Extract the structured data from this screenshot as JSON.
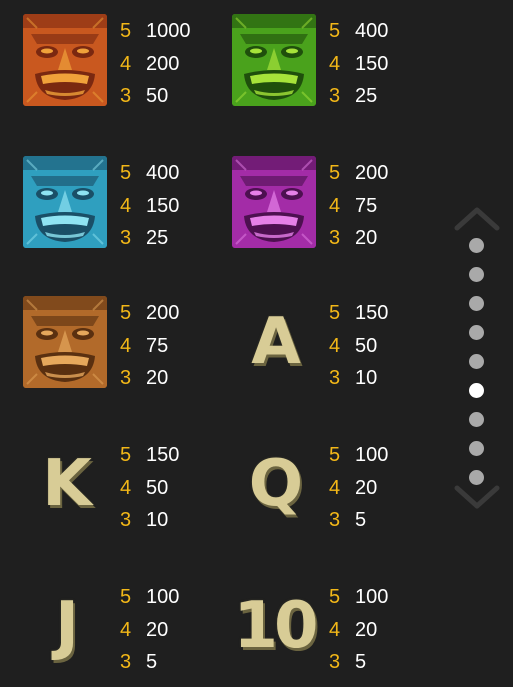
{
  "paytable": {
    "symbols": [
      {
        "name": "Red tiki mask",
        "kind": "mask",
        "colors": {
          "face": "#c9581f",
          "dark": "#7a2810",
          "light": "#f0a13a"
        },
        "pays": [
          {
            "count": "5",
            "value": "1000"
          },
          {
            "count": "4",
            "value": "200"
          },
          {
            "count": "3",
            "value": "50"
          }
        ]
      },
      {
        "name": "Green tiki mask",
        "kind": "mask",
        "colors": {
          "face": "#4aa21c",
          "dark": "#1f4f0c",
          "light": "#a6e33a"
        },
        "pays": [
          {
            "count": "5",
            "value": "400"
          },
          {
            "count": "4",
            "value": "150"
          },
          {
            "count": "3",
            "value": "25"
          }
        ]
      },
      {
        "name": "Blue tiki mask",
        "kind": "mask",
        "colors": {
          "face": "#2f9fbf",
          "dark": "#1a4f67",
          "light": "#8fe3f2"
        },
        "pays": [
          {
            "count": "5",
            "value": "400"
          },
          {
            "count": "4",
            "value": "150"
          },
          {
            "count": "3",
            "value": "25"
          }
        ]
      },
      {
        "name": "Purple tiki mask",
        "kind": "mask",
        "colors": {
          "face": "#a32ca7",
          "dark": "#4d1050",
          "light": "#e680e8"
        },
        "pays": [
          {
            "count": "5",
            "value": "200"
          },
          {
            "count": "4",
            "value": "75"
          },
          {
            "count": "3",
            "value": "20"
          }
        ]
      },
      {
        "name": "Brown tiki mask",
        "kind": "mask",
        "colors": {
          "face": "#b26a2a",
          "dark": "#5a3010",
          "light": "#e6a85c"
        },
        "pays": [
          {
            "count": "5",
            "value": "200"
          },
          {
            "count": "4",
            "value": "75"
          },
          {
            "count": "3",
            "value": "20"
          }
        ]
      },
      {
        "name": "A",
        "kind": "letter",
        "glyph": "A",
        "pays": [
          {
            "count": "5",
            "value": "150"
          },
          {
            "count": "4",
            "value": "50"
          },
          {
            "count": "3",
            "value": "10"
          }
        ]
      },
      {
        "name": "K",
        "kind": "letter",
        "glyph": "K",
        "pays": [
          {
            "count": "5",
            "value": "150"
          },
          {
            "count": "4",
            "value": "50"
          },
          {
            "count": "3",
            "value": "10"
          }
        ]
      },
      {
        "name": "Q",
        "kind": "letter",
        "glyph": "Q",
        "pays": [
          {
            "count": "5",
            "value": "100"
          },
          {
            "count": "4",
            "value": "20"
          },
          {
            "count": "3",
            "value": "5"
          }
        ]
      },
      {
        "name": "J",
        "kind": "letter",
        "glyph": "J",
        "pays": [
          {
            "count": "5",
            "value": "100"
          },
          {
            "count": "4",
            "value": "20"
          },
          {
            "count": "3",
            "value": "5"
          }
        ]
      },
      {
        "name": "10",
        "kind": "letter",
        "glyph": "10",
        "pays": [
          {
            "count": "5",
            "value": "100"
          },
          {
            "count": "4",
            "value": "20"
          },
          {
            "count": "3",
            "value": "5"
          }
        ]
      }
    ]
  },
  "pager": {
    "up_icon": "chevron-up-icon",
    "down_icon": "chevron-down-icon",
    "total_pages": 9,
    "active_page": 6
  },
  "colors": {
    "background": "#1f1f1f",
    "pay_count": "#f2b718",
    "pay_value": "#ffffff",
    "dot": "#a9a9a9",
    "dot_active": "#ffffff",
    "chevron": "#3a3a3a"
  }
}
